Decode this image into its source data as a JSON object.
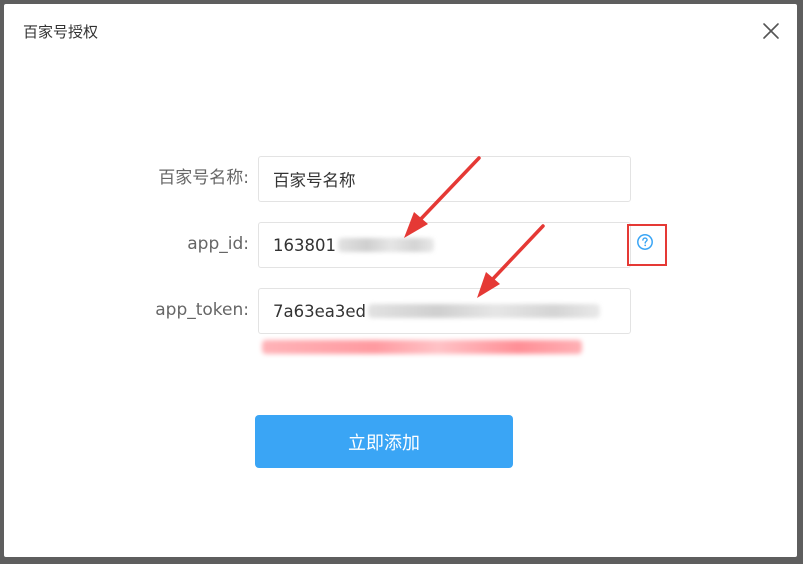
{
  "dialog": {
    "title": "百家号授权"
  },
  "form": {
    "name": {
      "label": "百家号名称:",
      "value": "百家号名称"
    },
    "app_id": {
      "label": "app_id:",
      "value": "163801"
    },
    "app_token": {
      "label": "app_token:",
      "value": "7a63ea3ed"
    }
  },
  "submit_label": "立即添加",
  "colors": {
    "primary": "#3aa5f5",
    "annotation_red": "#e53935",
    "overlay": "#5e5e5e"
  },
  "icons": {
    "close": "close-icon",
    "help": "question-circle-icon"
  }
}
